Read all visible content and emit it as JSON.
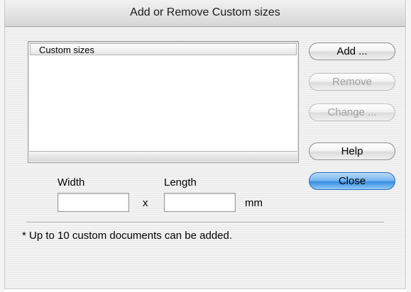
{
  "window": {
    "title": "Add or Remove Custom sizes"
  },
  "list": {
    "header": "Custom sizes",
    "items": []
  },
  "buttons": {
    "add": "Add ...",
    "remove": "Remove",
    "change": "Change ...",
    "help": "Help",
    "close": "Close"
  },
  "size": {
    "width_label": "Width",
    "length_label": "Length",
    "separator": "x",
    "unit": "mm",
    "width_value": "",
    "length_value": ""
  },
  "note": "* Up to 10 custom documents can be added.",
  "colors": {
    "default_button": "#3b8fe2",
    "disabled_text": "#a0a0a0"
  }
}
